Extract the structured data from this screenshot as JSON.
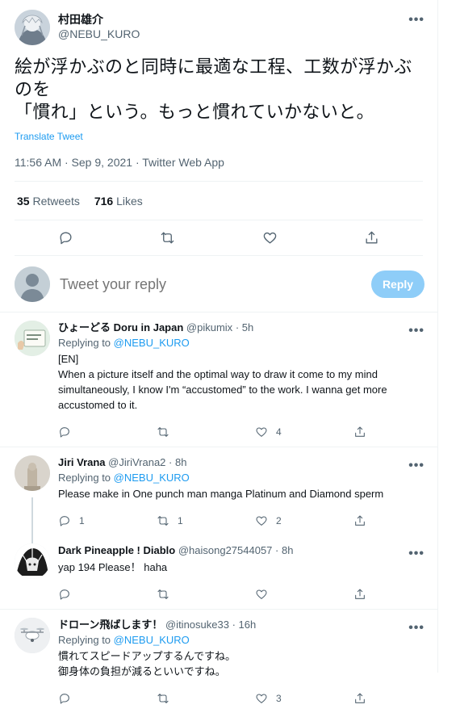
{
  "main": {
    "author": {
      "name": "村田雄介",
      "handle": "@NEBU_KURO"
    },
    "text_line1": "絵が浮かぶのと同時に最適な工程、工数が浮かぶのを",
    "text_line2": "「慣れ」という。もっと慣れていかないと。",
    "translate": "Translate Tweet",
    "meta": "11:56 AM · Sep 9, 2021 · Twitter Web App",
    "retweets": "35",
    "retweets_label": "Retweets",
    "likes": "716",
    "likes_label": "Likes",
    "more": "•••"
  },
  "reply_box": {
    "placeholder": "Tweet your reply",
    "button": "Reply"
  },
  "replies": [
    {
      "name": "ひょーどる Doru in Japan",
      "handle": "@pikumix",
      "time": "· 5h",
      "replying_prefix": "Replying to ",
      "replying_to": "@NEBU_KURO",
      "lines": [
        "[EN]",
        "When a picture itself and the optimal way to draw it come to my mind",
        "simultaneously, I know I'm “accustomed” to the work. I wanna get more",
        "accustomed to it."
      ],
      "counts": {
        "reply": "",
        "retweet": "",
        "like": "4"
      }
    },
    {
      "name": "Jiri Vrana",
      "handle": "@JiriVrana2",
      "time": "· 8h",
      "replying_prefix": "Replying to ",
      "replying_to": "@NEBU_KURO",
      "lines": [
        "Please make in One punch man manga Platinum and Diamond sperm"
      ],
      "counts": {
        "reply": "1",
        "retweet": "1",
        "like": "2"
      }
    },
    {
      "name": "Dark Pineapple ! Diablo",
      "handle": "@haisong27544057",
      "time": "· 8h",
      "lines": [
        "yap 194 Please！ haha"
      ],
      "counts": {
        "reply": "",
        "retweet": "",
        "like": ""
      }
    },
    {
      "name": "ドローン飛ばします！",
      "handle": "@itinosuke33",
      "time": "· 16h",
      "replying_prefix": "Replying to ",
      "replying_to": "@NEBU_KURO",
      "lines": [
        "慣れてスピードアップするんですね。",
        "御身体の負担が減るといいですね。"
      ],
      "counts": {
        "reply": "",
        "retweet": "",
        "like": "3"
      }
    }
  ],
  "colors": {
    "accent": "#1d9bf0",
    "muted": "#536471",
    "text": "#0f1419",
    "reply_button": "#8ecdf8"
  }
}
